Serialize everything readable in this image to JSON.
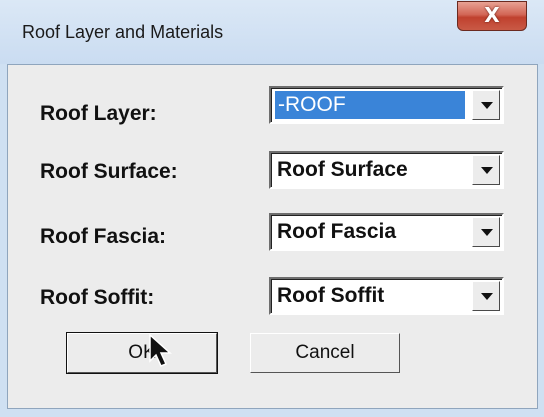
{
  "window": {
    "title": "Roof Layer and Materials",
    "close_label": "X"
  },
  "fields": [
    {
      "label": "Roof Layer:",
      "value": "-ROOF"
    },
    {
      "label": "Roof Surface:",
      "value": "Roof Surface"
    },
    {
      "label": "Roof Fascia:",
      "value": "Roof Fascia"
    },
    {
      "label": "Roof Soffit:",
      "value": "Roof Soffit"
    }
  ],
  "buttons": {
    "ok": "OK",
    "cancel": "Cancel"
  },
  "colors": {
    "selection": "#3a84d8",
    "close_button": "#c0412e"
  }
}
